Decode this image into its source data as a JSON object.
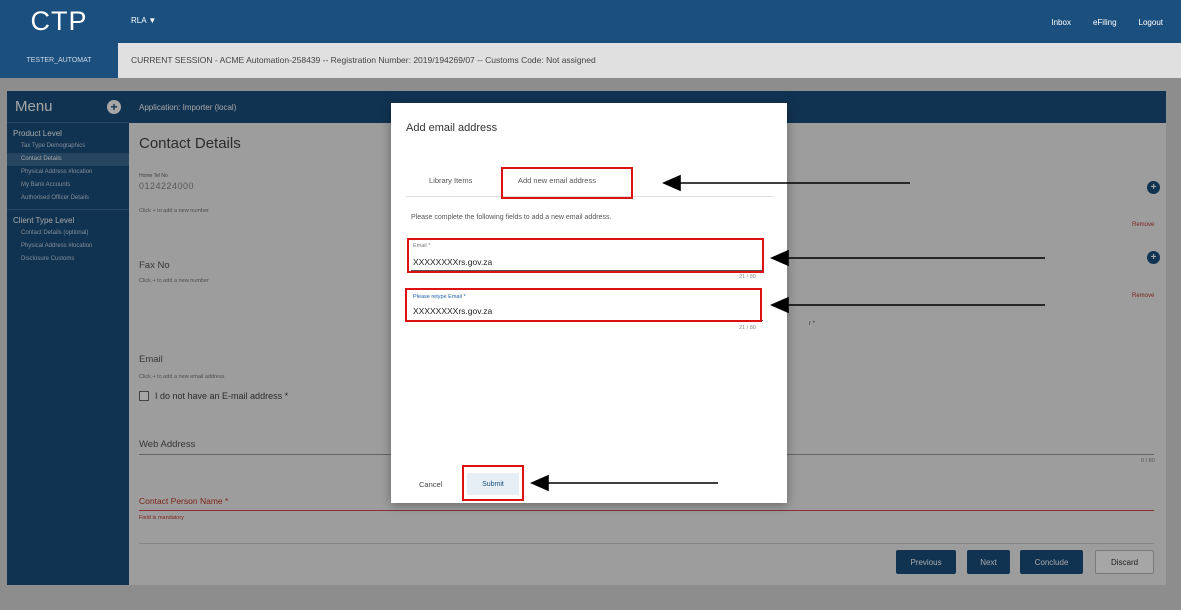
{
  "header": {
    "logo": "CTP",
    "app_switch": "RLA ▼",
    "links": [
      "Inbox",
      "eFiling",
      "Logout"
    ]
  },
  "session": {
    "user": "TESTER_AUTOMAT",
    "text": "CURRENT SESSION - ACME Automation-258439 -- Registration Number: 2019/194269/07 -- Customs Code: Not assigned"
  },
  "sidebar": {
    "title": "Menu",
    "product_level": "Product Level",
    "product_items": [
      "Tax Type Demographics",
      "Contact Details",
      "Physical Address #location",
      "My Bank Accounts",
      "Authorised Officer Details"
    ],
    "client_level": "Client Type Level",
    "client_items": [
      "Contact Details (optional)",
      "Physical Address #location",
      "Disclosure Customs"
    ]
  },
  "main": {
    "application": "Application: Importer (local)",
    "heading": "Contact Details",
    "home_tel_label": "Home Tel No",
    "home_tel_value": "0124224000",
    "hint_number": "Click + to add a new number",
    "remove": "Remove",
    "fax_title": "Fax No",
    "email_title": "Email",
    "hint_email": "Click + to add a new email address",
    "no_email": "I do not have an E-mail address *",
    "web_title": "Web Address",
    "web_count": "0 / 80",
    "contact_person": "Contact Person Name *",
    "mandatory": "Field is mandatory",
    "partial_text": "r *",
    "buttons": {
      "previous": "Previous",
      "next": "Next",
      "conclude": "Conclude",
      "discard": "Discard"
    }
  },
  "modal": {
    "title": "Add email address",
    "tabs": [
      "Library Items",
      "Add new email address"
    ],
    "instruction": "Please complete the following fields to add a new email address.",
    "email_label": "Email *",
    "email_value": "XXXXXXXXrs.gov.za",
    "email_count": "21 / 80",
    "retype_label": "Please retype Email *",
    "retype_value": "XXXXXXXXrs.gov.za",
    "retype_count": "21 / 80",
    "cancel": "Cancel",
    "submit": "Submit"
  },
  "colors": {
    "primary": "#1b4f7e",
    "error": "#c0392b",
    "annotation": "#dd1111"
  }
}
